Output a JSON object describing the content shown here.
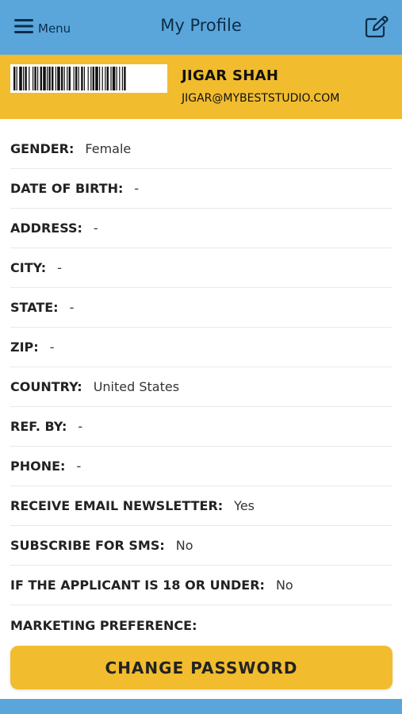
{
  "header": {
    "menu_label": "Menu",
    "title": "My Profile",
    "menu_icon": "hamburger-icon",
    "edit_icon": "edit-icon"
  },
  "profile": {
    "name": "JIGAR SHAH",
    "email": "JIGAR@MYBESTSTUDIO.COM",
    "barcode_icon": "barcode"
  },
  "fields": [
    {
      "label": "GENDER:",
      "value": "Female"
    },
    {
      "label": "DATE OF BIRTH:",
      "value": "-"
    },
    {
      "label": "ADDRESS:",
      "value": "-"
    },
    {
      "label": "CITY:",
      "value": "-"
    },
    {
      "label": "STATE:",
      "value": "-"
    },
    {
      "label": "ZIP:",
      "value": "-"
    },
    {
      "label": "COUNTRY:",
      "value": "United States"
    },
    {
      "label": "REF. BY:",
      "value": "-"
    },
    {
      "label": "PHONE:",
      "value": "-"
    },
    {
      "label": "RECEIVE EMAIL NEWSLETTER:",
      "value": "Yes"
    },
    {
      "label": "SUBSCRIBE FOR SMS:",
      "value": "No"
    },
    {
      "label": "IF THE APPLICANT IS 18 OR UNDER:",
      "value": "No"
    },
    {
      "label": "MARKETING PREFERENCE:",
      "value": ""
    }
  ],
  "actions": {
    "change_password_label": "CHANGE PASSWORD"
  },
  "colors": {
    "nav_bg": "#5aa6db",
    "accent": "#f1bc2e",
    "nav_text": "#0d2d48"
  }
}
